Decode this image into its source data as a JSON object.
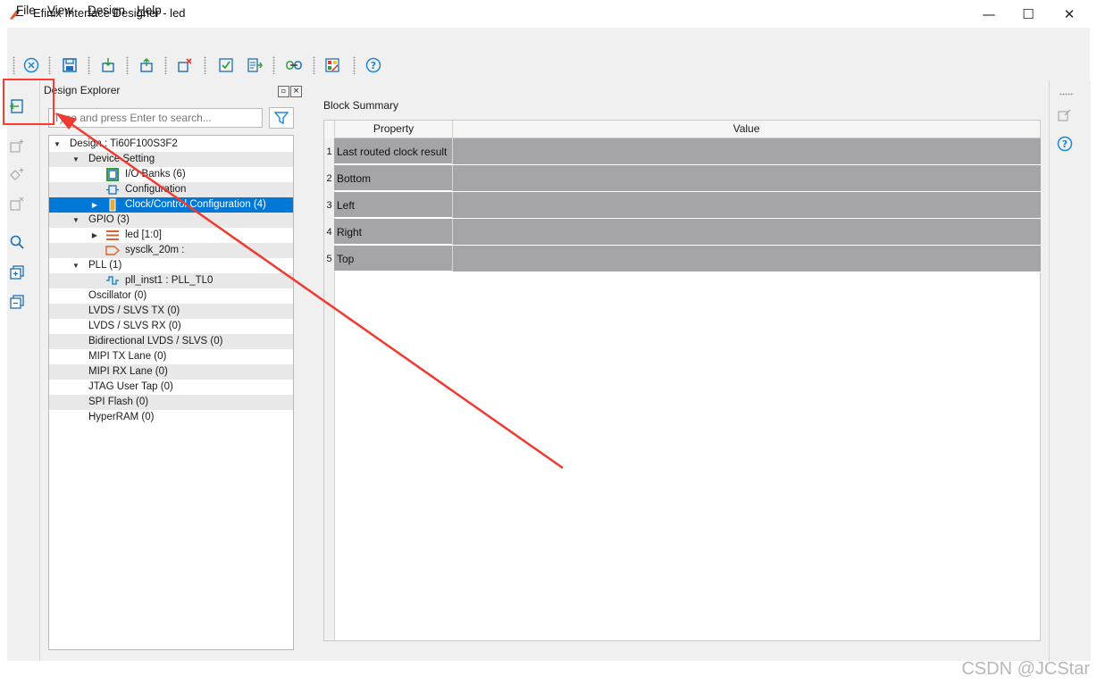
{
  "window": {
    "title": "Efinix Interface Designer - led",
    "minimize": "—",
    "maximize": "☐",
    "close": "✕"
  },
  "menu": {
    "file_key": "F",
    "file_rest": "ile",
    "view_key": "V",
    "view_rest": "iew",
    "design_key": "D",
    "design_rest": "esign",
    "help_key": "H",
    "help_rest": "elp"
  },
  "toolbar": {
    "icons": [
      "close-design-icon",
      "save-icon",
      "import-icon",
      "export-icon",
      "delete-icon",
      "check-icon",
      "generate-icon",
      "link-icon",
      "color-grid-icon",
      "help-icon"
    ]
  },
  "explorer": {
    "title": "Design Explorer",
    "search_placeholder": "Type and press Enter to search...",
    "tree": [
      {
        "label": "Design : Ti60F100S3F2",
        "level": 0,
        "expanded": true
      },
      {
        "label": "Device Setting",
        "level": 1,
        "expanded": true
      },
      {
        "label": "I/O Banks (6)",
        "level": 2
      },
      {
        "label": "Configuration",
        "level": 2
      },
      {
        "label": "Clock/Control Configuration (4)",
        "level": 2,
        "selected": true
      },
      {
        "label": "GPIO (3)",
        "level": 1,
        "expanded": true
      },
      {
        "label": "led [1:0]",
        "level": 2
      },
      {
        "label": "sysclk_20m :",
        "level": 2
      },
      {
        "label": "PLL (1)",
        "level": 1,
        "expanded": true
      },
      {
        "label": "pll_inst1 : PLL_TL0",
        "level": 2
      },
      {
        "label": "Oscillator (0)",
        "level": 1
      },
      {
        "label": "LVDS / SLVS TX (0)",
        "level": 1
      },
      {
        "label": "LVDS / SLVS RX (0)",
        "level": 1
      },
      {
        "label": "Bidirectional LVDS / SLVS (0)",
        "level": 1
      },
      {
        "label": "MIPI TX Lane (0)",
        "level": 1
      },
      {
        "label": "MIPI RX Lane (0)",
        "level": 1
      },
      {
        "label": "JTAG User Tap (0)",
        "level": 1
      },
      {
        "label": "SPI Flash (0)",
        "level": 1
      },
      {
        "label": "HyperRAM (0)",
        "level": 1
      }
    ]
  },
  "summary": {
    "title": "Block Summary",
    "col_property": "Property",
    "col_value": "Value",
    "rows": [
      {
        "num": "1",
        "property": "Last routed clock result",
        "value": ""
      },
      {
        "num": "2",
        "property": "Bottom",
        "value": ""
      },
      {
        "num": "3",
        "property": "Left",
        "value": ""
      },
      {
        "num": "4",
        "property": "Right",
        "value": ""
      },
      {
        "num": "5",
        "property": "Top",
        "value": ""
      }
    ]
  },
  "watermark": "CSDN @JCStar",
  "colors": {
    "selection": "#0078d7",
    "annotation": "#ff3b30",
    "row_fill": "#a5a4a9"
  }
}
